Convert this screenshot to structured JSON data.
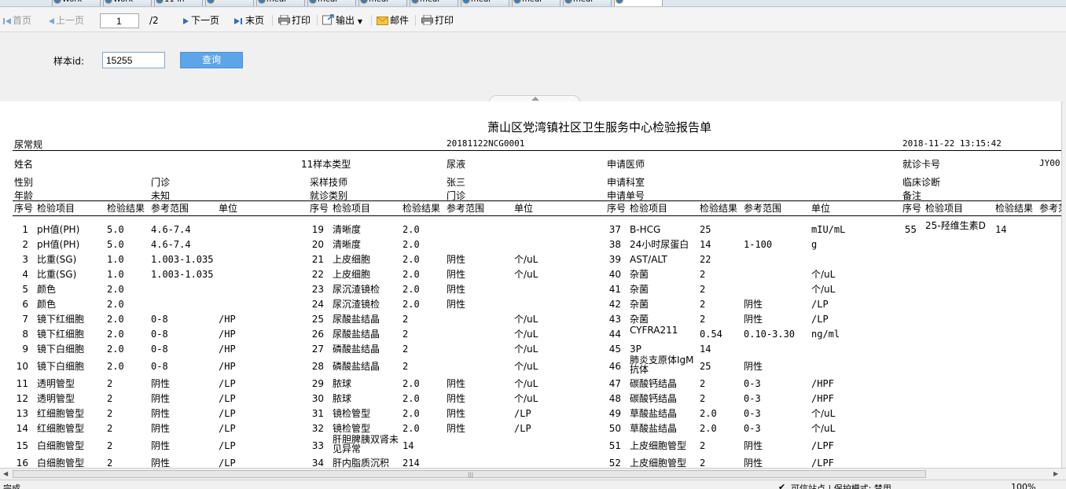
{
  "browser_tabs": [
    {
      "label": "Work",
      "active": false
    },
    {
      "label": "Work",
      "active": false
    },
    {
      "label": "11-in",
      "active": false
    },
    {
      "label": "",
      "active": false
    },
    {
      "label": "medi",
      "active": false
    },
    {
      "label": "medi",
      "active": false
    },
    {
      "label": "medi",
      "active": false
    },
    {
      "label": "medi",
      "active": false
    },
    {
      "label": "medi",
      "active": false
    },
    {
      "label": "medi",
      "active": false
    },
    {
      "label": "medi",
      "active": false
    },
    {
      "label": "",
      "active": true
    }
  ],
  "toolbar": {
    "first": "首页",
    "prev": "上一页",
    "page_value": "1",
    "page_total": "/2",
    "next": "下一页",
    "last": "末页",
    "print1": "打印",
    "export": "输出",
    "mail": "邮件",
    "print2": "打印"
  },
  "search": {
    "label": "样本id:",
    "value": "15255",
    "button": "查询"
  },
  "report": {
    "title": "萧山区党湾镇社区卫生服务中心检验报告单",
    "category": "尿常规",
    "barcode": "20181122NCG0001",
    "datetime": "2018-11-22 13:15:42",
    "info": {
      "name_label": "姓名",
      "sample_type_label": "11样本类型",
      "sample_type": "尿液",
      "doctor_label": "申请医师",
      "card_label": "就诊卡号",
      "card_value": "JY00",
      "sex_label": "性别",
      "sex_value": "门诊",
      "tech_label": "采样技师",
      "tech_value": "张三",
      "dept_label": "申请科室",
      "diagnosis_label": "临床诊断",
      "age_label": "年龄",
      "age_value": "未知",
      "visit_label": "就诊类别",
      "visit_value": "门诊",
      "order_label": "申请单号",
      "remark_label": "备注"
    },
    "headers": [
      "序号",
      "检验项目",
      "检验结果",
      "参考范围",
      "单位"
    ],
    "columns": [
      [
        [
          "1",
          "pH值(PH)",
          "5.0",
          "4.6-7.4",
          ""
        ],
        [
          "2",
          "pH值(PH)",
          "5.0",
          "4.6-7.4",
          ""
        ],
        [
          "3",
          "比重(SG)",
          "1.0",
          "1.003-1.035",
          ""
        ],
        [
          "4",
          "比重(SG)",
          "1.0",
          "1.003-1.035",
          ""
        ],
        [
          "5",
          "颜色",
          "2.0",
          "",
          ""
        ],
        [
          "6",
          "颜色",
          "2.0",
          "",
          ""
        ],
        [
          "7",
          "镜下红细胞",
          "2.0",
          "0-8",
          "/HP"
        ],
        [
          "8",
          "镜下红细胞",
          "2.0",
          "0-8",
          "/HP"
        ],
        [
          "9",
          "镜下白细胞",
          "2.0",
          "0-8",
          "/HP"
        ],
        [
          "10",
          "镜下白细胞",
          "2.0",
          "0-8",
          "/HP"
        ],
        [
          "11",
          "透明管型",
          "2",
          "阴性",
          "/LP"
        ],
        [
          "12",
          "透明管型",
          "2",
          "阴性",
          "/LP"
        ],
        [
          "13",
          "红细胞管型",
          "2",
          "阴性",
          "/LP"
        ],
        [
          "14",
          "红细胞管型",
          "2",
          "阴性",
          "/LP"
        ],
        [
          "15",
          "白细胞管型",
          "2",
          "阴性",
          "/LP"
        ],
        [
          "16",
          "白细胞管型",
          "2",
          "阴性",
          "/LP"
        ]
      ],
      [
        [
          "19",
          "清晰度",
          "2.0",
          "",
          ""
        ],
        [
          "20",
          "清晰度",
          "2.0",
          "",
          ""
        ],
        [
          "21",
          "上皮细胞",
          "2.0",
          "阴性",
          "个/uL"
        ],
        [
          "22",
          "上皮细胞",
          "2.0",
          "阴性",
          "个/uL"
        ],
        [
          "23",
          "尿沉渣镜检",
          "2.0",
          "阴性",
          ""
        ],
        [
          "24",
          "尿沉渣镜检",
          "2.0",
          "阴性",
          ""
        ],
        [
          "25",
          "尿酸盐结晶",
          "2",
          "",
          "个/uL"
        ],
        [
          "26",
          "尿酸盐结晶",
          "2",
          "",
          "个/uL"
        ],
        [
          "27",
          "磷酸盐结晶",
          "2",
          "",
          "个/uL"
        ],
        [
          "28",
          "磷酸盐结晶",
          "2",
          "",
          "个/uL"
        ],
        [
          "29",
          "脓球",
          "2.0",
          "阴性",
          "个/uL"
        ],
        [
          "30",
          "脓球",
          "2.0",
          "阴性",
          "个/uL"
        ],
        [
          "31",
          "镜检管型",
          "2.0",
          "阴性",
          "/LP"
        ],
        [
          "32",
          "镜检管型",
          "2.0",
          "阴性",
          "/LP"
        ],
        [
          "33",
          "肝胆脾胰双肾未见异常",
          "14",
          "",
          ""
        ],
        [
          "34",
          "肝内脂质沉积",
          "214",
          "",
          ""
        ]
      ],
      [
        [
          "37",
          "B-HCG",
          "25",
          "",
          "mIU/mL"
        ],
        [
          "38",
          "24小时尿蛋白",
          "14",
          "1-100",
          "g"
        ],
        [
          "39",
          "AST/ALT",
          "22",
          "",
          ""
        ],
        [
          "40",
          "杂菌",
          "2",
          "",
          "个/uL"
        ],
        [
          "41",
          "杂菌",
          "2",
          "",
          "个/uL"
        ],
        [
          "42",
          "杂菌",
          "2",
          "阴性",
          "/LP"
        ],
        [
          "43",
          "杂菌",
          "2",
          "阴性",
          "/LP"
        ],
        [
          "44",
          "CYFRA211",
          "0.54",
          "0.10-3.30",
          "ng/ml"
        ],
        [
          "45",
          "3P",
          "14",
          "",
          ""
        ],
        [
          "46",
          "肺炎支原体IgM抗体",
          "25",
          "阴性",
          ""
        ],
        [
          "47",
          "碳酸钙结晶",
          "2",
          "0-3",
          "/HPF"
        ],
        [
          "48",
          "碳酸钙结晶",
          "2",
          "0-3",
          "/HPF"
        ],
        [
          "49",
          "草酸盐结晶",
          "2.0",
          "0-3",
          "个/uL"
        ],
        [
          "50",
          "草酸盐结晶",
          "2.0",
          "0-3",
          "个/uL"
        ],
        [
          "51",
          "上皮细胞管型",
          "2",
          "阴性",
          "/LPF"
        ],
        [
          "52",
          "上皮细胞管型",
          "2",
          "阴性",
          "/LPF"
        ]
      ],
      [
        [
          "55",
          "25-羟维生素D",
          "14",
          "",
          ""
        ]
      ]
    ]
  },
  "statusbar": {
    "left": "完成",
    "right": "可信站点 | 保护模式: 禁用",
    "zoom": "100%"
  }
}
